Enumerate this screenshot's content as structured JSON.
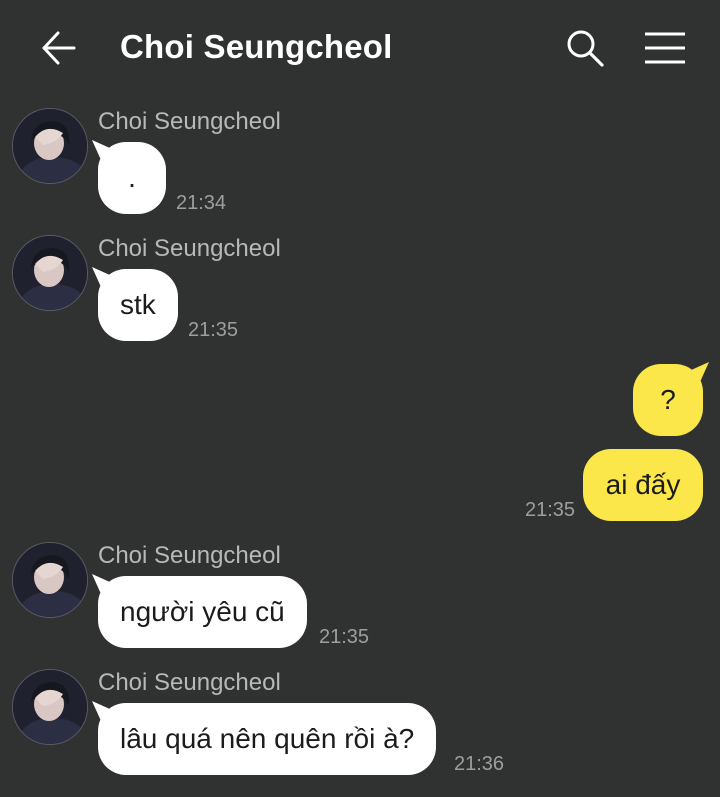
{
  "header": {
    "title": "Choi Seungcheol",
    "back_icon": "arrow-left-icon",
    "search_icon": "search-icon",
    "menu_icon": "hamburger-menu-icon"
  },
  "messages": [
    {
      "direction": "incoming",
      "sender": "Choi Seungcheol",
      "text": ".",
      "time": "21:34"
    },
    {
      "direction": "incoming",
      "sender": "Choi Seungcheol",
      "text": "stk",
      "time": "21:35"
    },
    {
      "direction": "outgoing",
      "text": "?",
      "time": ""
    },
    {
      "direction": "outgoing",
      "text": "ai đấy",
      "time": "21:35"
    },
    {
      "direction": "incoming",
      "sender": "Choi Seungcheol",
      "text": "người yêu cũ",
      "time": "21:35"
    },
    {
      "direction": "incoming",
      "sender": "Choi Seungcheol",
      "text": "lâu quá nên quên rồi à?",
      "time": "21:36"
    }
  ],
  "colors": {
    "background": "#303231",
    "incoming_bubble": "#ffffff",
    "outgoing_bubble": "#fbe74a",
    "sender_text": "#b8b8b8",
    "time_text": "#9e9e9e"
  }
}
